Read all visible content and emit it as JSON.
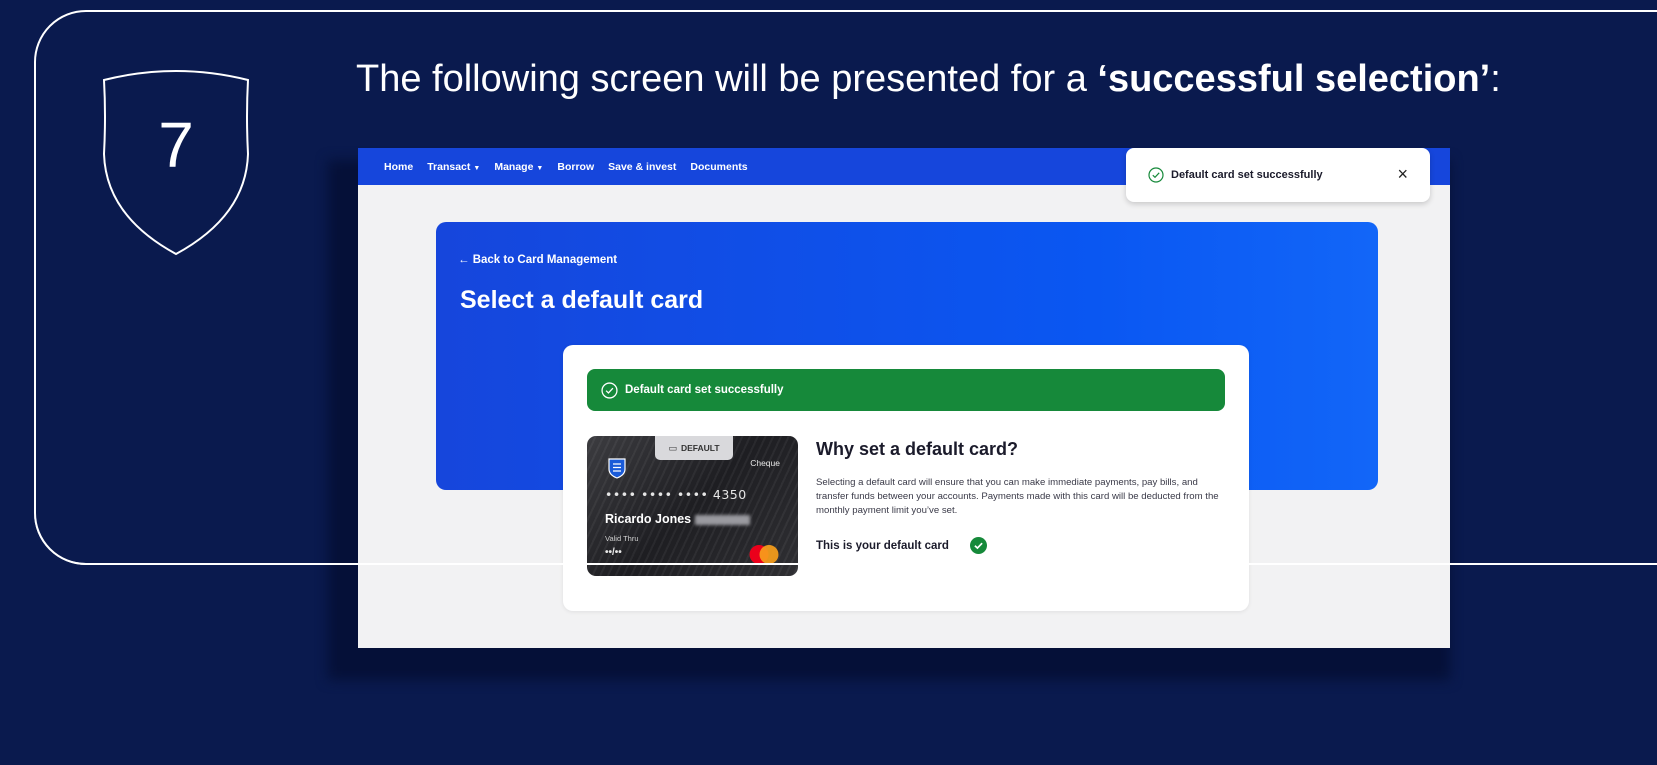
{
  "step": {
    "number": "7",
    "heading_prefix": "The following screen will be presented for a ",
    "heading_bold": "‘successful selection’",
    "heading_suffix": ":"
  },
  "navbar": {
    "items": [
      {
        "label": "Home",
        "dropdown": false
      },
      {
        "label": "Transact",
        "dropdown": true
      },
      {
        "label": "Manage",
        "dropdown": true
      },
      {
        "label": "Borrow",
        "dropdown": false
      },
      {
        "label": "Save & invest",
        "dropdown": false
      },
      {
        "label": "Documents",
        "dropdown": false
      }
    ]
  },
  "toast": {
    "message": "Default card set successfully",
    "close_label": "×",
    "icon": "check-circle-icon"
  },
  "page": {
    "back_link": "← Back to Card Management",
    "title": "Select a default card"
  },
  "banner": {
    "message": "Default card set successfully",
    "icon": "check-circle-icon"
  },
  "card": {
    "tag": "DEFAULT",
    "type": "Cheque",
    "number": "•••• •••• •••• 4350",
    "holder": "Ricardo Jones",
    "valid_label": "Valid Thru",
    "expiry": "••/••"
  },
  "info": {
    "title": "Why set a default card?",
    "description": "Selecting a default card will ensure that you can make immediate payments, pay bills, and transfer funds between your accounts. Payments made with this card will be deducted from the monthly payment limit you’ve set.",
    "status": "This is your default card"
  },
  "colors": {
    "background": "#0a1a4e",
    "nav_blue": "#1646dc",
    "success_green": "#16893a",
    "mastercard_red": "#eb001b",
    "mastercard_orange": "#f79e1b"
  }
}
